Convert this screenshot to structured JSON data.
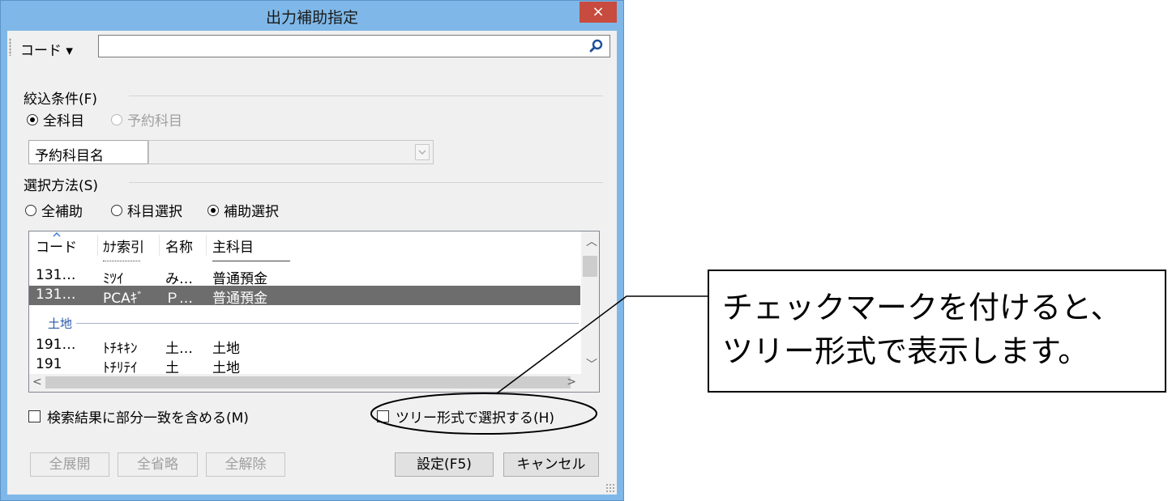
{
  "window": {
    "title": "出力補助指定",
    "close_label": "×"
  },
  "toolbar": {
    "code_label": "コード ▾",
    "search_value": "",
    "search_icon": "search-icon"
  },
  "filter": {
    "label": "絞込条件(F)",
    "radios": [
      {
        "label": "全科目",
        "checked": true,
        "enabled": true
      },
      {
        "label": "予約科目",
        "checked": false,
        "enabled": false
      }
    ],
    "reserved_name_label": "予約科目名",
    "reserved_name_value": ""
  },
  "selection": {
    "label": "選択方法(S)",
    "radios": [
      {
        "label": "全補助",
        "checked": false
      },
      {
        "label": "科目選択",
        "checked": false
      },
      {
        "label": "補助選択",
        "checked": true
      }
    ]
  },
  "list": {
    "columns": [
      "コード",
      "ｶﾅ索引",
      "名称",
      "主科目"
    ],
    "rows": [
      {
        "code": "131…",
        "kana": "ﾐﾂｲ",
        "name": "み…",
        "account": "普通預金",
        "selected": false
      },
      {
        "code": "131…",
        "kana": "PCAｷﾞ",
        "name": "Ｐ…",
        "account": "普通預金",
        "selected": true
      }
    ],
    "group": "土地",
    "group_rows": [
      {
        "code": "191…",
        "kana": "ﾄﾁｷｷﾝ",
        "name": "土…",
        "account": "土地"
      },
      {
        "code": "191",
        "kana": "ﾄﾁﾘﾃｲ",
        "name": "土",
        "account": "土地"
      }
    ]
  },
  "options": {
    "partial_match_label": "検索結果に部分一致を含める(M)",
    "partial_match_checked": false,
    "tree_select_label": "ツリー形式で選択する(H)",
    "tree_select_checked": false
  },
  "buttons": {
    "expand_all": "全展開",
    "collapse_all": "全省略",
    "clear_all": "全解除",
    "set": "設定(F5)",
    "cancel": "キャンセル"
  },
  "callout": {
    "line1": "チェックマークを付けると、",
    "line2": "ツリー形式で表示します。"
  }
}
